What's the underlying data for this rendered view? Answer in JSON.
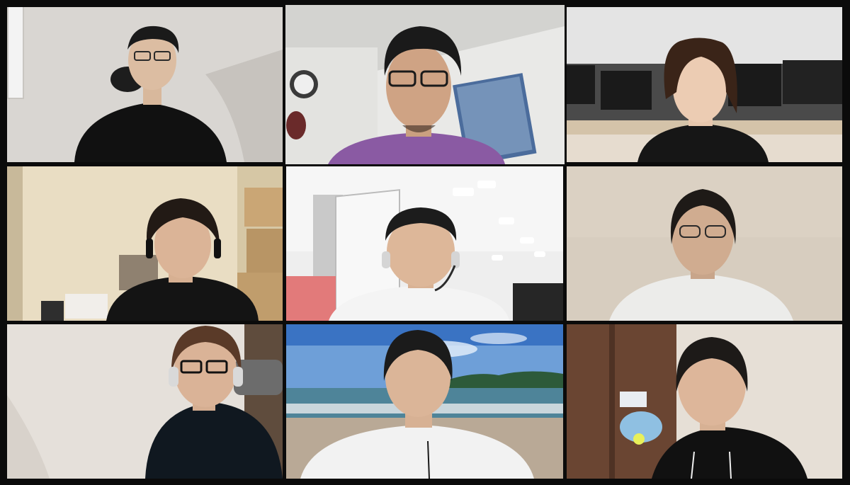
{
  "window": {
    "title": ""
  },
  "gallery": {
    "layout": "3x3",
    "active_speaker_border_color": "#d6ee7a",
    "participants": [
      {
        "id": "p1",
        "background": "white-room",
        "shirt_color": "#111111",
        "active": false
      },
      {
        "id": "p2",
        "background": "office-corner",
        "shirt_color": "#8a5aa3",
        "active": true
      },
      {
        "id": "p3",
        "background": "open-office",
        "shirt_color": "#161616",
        "active": false
      },
      {
        "id": "p4",
        "background": "room-with-boxes",
        "shirt_color": "#141414",
        "active": false
      },
      {
        "id": "p5",
        "background": "office-whiteboard",
        "shirt_color": "#f4f4f4",
        "active": false
      },
      {
        "id": "p6",
        "background": "beige-wall",
        "shirt_color": "#eeeeee",
        "active": false
      },
      {
        "id": "p7",
        "background": "white-room-chair",
        "shirt_color": "#101820",
        "active": false
      },
      {
        "id": "p8",
        "background": "beach-virtual",
        "shirt_color": "#f2f2f2",
        "active": false
      },
      {
        "id": "p9",
        "background": "wood-door-room",
        "shirt_color": "#111111",
        "active": false
      }
    ]
  }
}
